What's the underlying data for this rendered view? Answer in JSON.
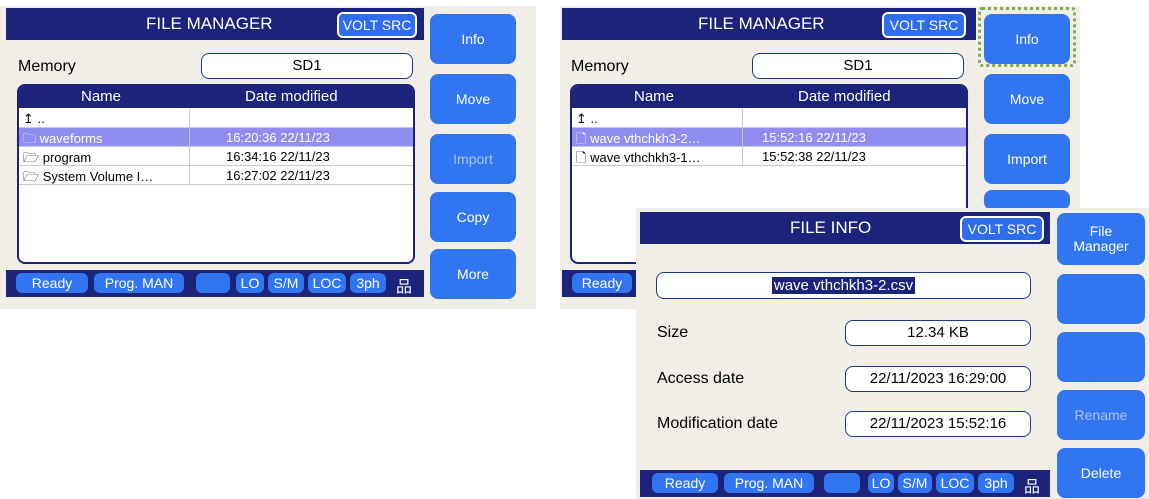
{
  "left": {
    "title": "FILE MANAGER",
    "badge": "VOLT SRC",
    "memory_label": "Memory",
    "memory_value": "SD1",
    "columns": [
      "Name",
      "Date modified"
    ],
    "rows": [
      {
        "icon": "↥",
        "name": "..",
        "date": "",
        "selected": false
      },
      {
        "icon": "🗀",
        "name": "waveforms",
        "date": "16:20:36 22/11/23",
        "selected": true
      },
      {
        "icon": "🗁",
        "name": "program",
        "date": "16:34:16 22/11/23",
        "selected": false
      },
      {
        "icon": "🗁",
        "name": "System Volume I…",
        "date": "16:27:02 22/11/23",
        "selected": false
      }
    ],
    "status": [
      "Ready",
      "Prog. MAN",
      "",
      "LO",
      "S/M",
      "LOC",
      "3ph"
    ],
    "network_icon": "品",
    "softkeys": [
      "Info",
      "Move",
      "Import",
      "Copy",
      "More"
    ]
  },
  "right": {
    "title": "FILE MANAGER",
    "badge": "VOLT SRC",
    "memory_label": "Memory",
    "memory_value": "SD1",
    "columns": [
      "Name",
      "Date modified"
    ],
    "rows": [
      {
        "icon": "↥",
        "name": "..",
        "date": "",
        "selected": false
      },
      {
        "icon": "🗋",
        "name": "wave vthchkh3-2…",
        "date": "15:52:16 22/11/23",
        "selected": true
      },
      {
        "icon": "🗋",
        "name": "wave vthchkh3-1…",
        "date": "15:52:38 22/11/23",
        "selected": false
      }
    ],
    "status_ready": "Ready",
    "softkeys": [
      "Info",
      "Move",
      "Import"
    ]
  },
  "fileinfo": {
    "title": "FILE INFO",
    "badge": "VOLT SRC",
    "filename": "wave vthchkh3-2.csv",
    "size_label": "Size",
    "size_value": "12.34 KB",
    "access_label": "Access date",
    "access_value": "22/11/2023 16:29:00",
    "mod_label": "Modification date",
    "mod_value": "22/11/2023 15:52:16",
    "status": [
      "Ready",
      "Prog. MAN",
      "",
      "LO",
      "S/M",
      "LOC",
      "3ph"
    ],
    "network_icon": "品",
    "softkeys": [
      "File Manager",
      "",
      "",
      "Rename",
      "Delete"
    ]
  },
  "colors": {
    "header": "#1c237a",
    "button": "#3176f0",
    "selection": "#8f8ef0",
    "panel": "#f1eee7",
    "focus": "#7fae4a"
  }
}
